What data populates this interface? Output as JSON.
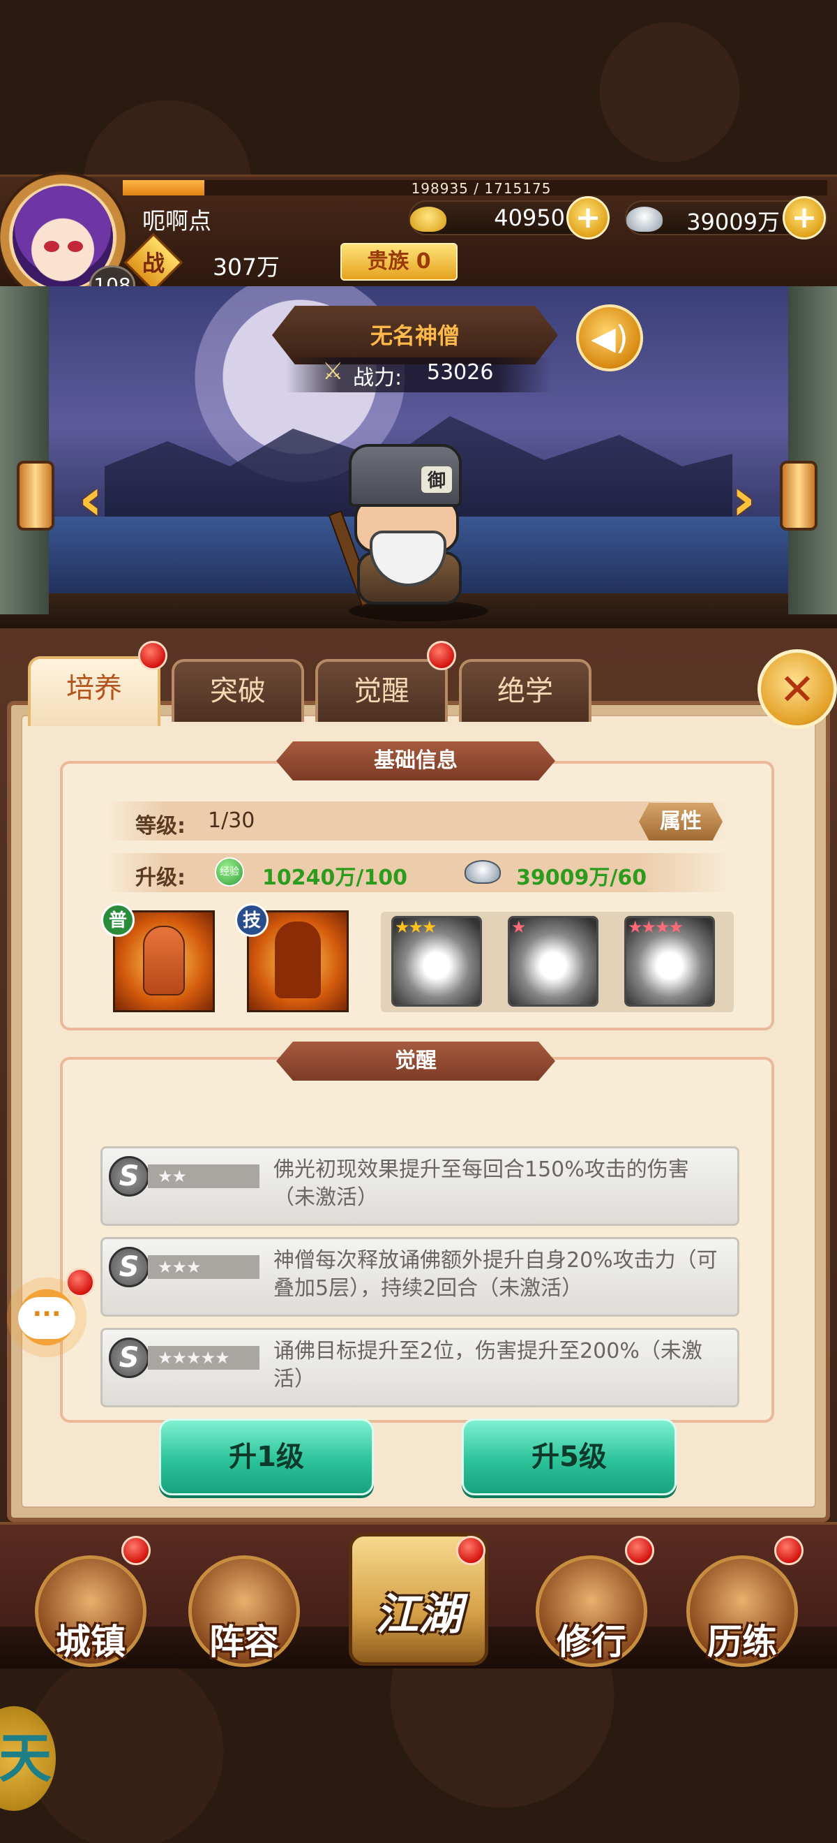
{
  "player": {
    "name": "呃啊点",
    "level": "108",
    "exp_text": "198935 / 1715175",
    "exp_progress": 0.116,
    "gold": "40950",
    "silver": "39009万",
    "power_label": "战",
    "power": "307万",
    "noble_label": "贵族 0"
  },
  "hero": {
    "name": "无名神僧",
    "power_label": "战力:",
    "power_value": "53026",
    "hat_emblem": "御"
  },
  "tabs": [
    {
      "label": "培养",
      "active": true
    },
    {
      "label": "突破"
    },
    {
      "label": "觉醒"
    },
    {
      "label": "绝学"
    }
  ],
  "basic_info": {
    "title": "基础信息",
    "level_label": "等级:",
    "level_value": "1/30",
    "attr_button": "属性",
    "upgrade_label": "升级:",
    "exp_item_icon_text": "经验",
    "exp_cost": "10240万/100",
    "silver_cost": "39009万/60",
    "skill_tags": [
      "普",
      "技"
    ],
    "locked_stars": [
      "★★★",
      "★",
      "★★★★"
    ]
  },
  "awaken": {
    "title": "觉醒",
    "badge_letter": "S",
    "rows": [
      {
        "stars": "★★",
        "text": "佛光初现效果提升至每回合150%攻击的伤害（未激活）"
      },
      {
        "stars": "★★★",
        "text": "神僧每次释放诵佛额外提升自身20%攻击力（可叠加5层），持续2回合（未激活）"
      },
      {
        "stars": "★★★★★",
        "text": "诵佛目标提升至2位，伤害提升至200%（未激活）"
      }
    ]
  },
  "buttons": {
    "level_up_1": "升1级",
    "level_up_5": "升5级"
  },
  "chat": {
    "icon_text": "···"
  },
  "nav": {
    "town": "城镇",
    "lineup": "阵容",
    "jianghu": "江湖",
    "train": "修行",
    "trial": "历练"
  },
  "corner_deco_text": "天",
  "colors": {
    "accent_gold": "#e2a21b",
    "green_text": "#2d9b1e",
    "badge_red": "#d4140e",
    "button_teal": "#2cc39a"
  }
}
